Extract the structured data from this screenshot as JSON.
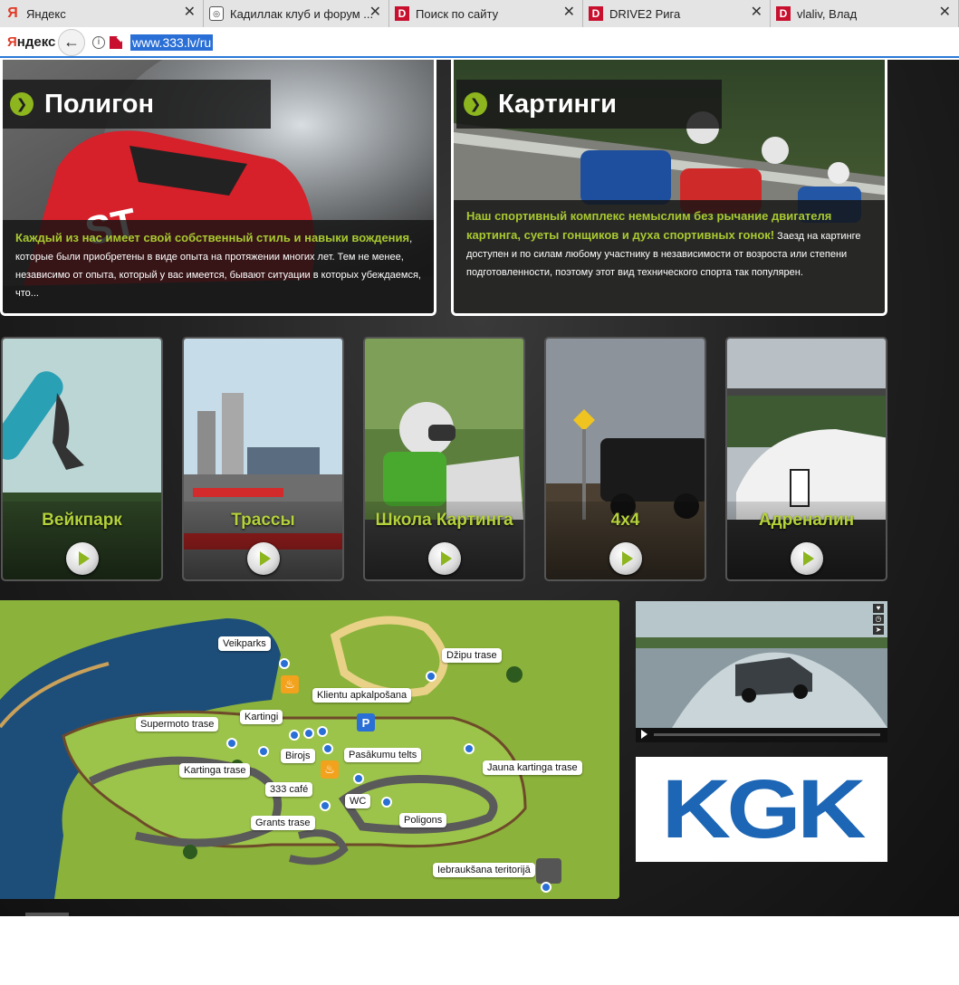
{
  "browser": {
    "tabs": [
      {
        "title": "Яндекс",
        "icon": "yandex-icon",
        "width": 225
      },
      {
        "title": "Кадиллак клуб и форум ...",
        "icon": "cadillac-icon",
        "width": 205
      },
      {
        "title": "Поиск по сайту",
        "icon": "drive2-icon",
        "width": 214
      },
      {
        "title": "DRIVE2 Рига",
        "icon": "drive2-icon",
        "width": 207
      },
      {
        "title": "vlaliv, Влад",
        "icon": "drive2-icon",
        "width": 208
      }
    ],
    "logo_prefix": "Я",
    "logo_rest": "ндекс",
    "url": "www.333.lv/ru"
  },
  "features": {
    "poligon": {
      "title": "Полигон",
      "lead": "Каждый из нас имеет свой собственный стиль и навыки вождения",
      "text": ", которые были приобретены в виде опыта на протяжении многих лет. Тем не менее, независимо от опыта, который у вас имеется, бывают ситуации в которых убеждаемся, что..."
    },
    "karting": {
      "title": "Картинги",
      "lead": "Наш спортивный комплекс немыслим без рычание двигателя картинга, суеты гонщиков и духа спортивных гонок!",
      "text": " Заезд на картинге доступен и по силам любому участнику в независимости от возроста или степени подготовленности, поэтому этот вид технического спорта так популярен."
    }
  },
  "tiles": [
    {
      "label": "Вейкпарк"
    },
    {
      "label": "Трассы"
    },
    {
      "label": "Школа Картинга"
    },
    {
      "label": "4x4"
    },
    {
      "label": "Адреналин"
    }
  ],
  "map": {
    "labels": {
      "veikparks": "Veikparks",
      "dzipu": "Džipu trase",
      "klientu": "Klientu apkalpošana",
      "kartingi": "Kartingi",
      "supermoto": "Supermoto trase",
      "birojs": "Birojs",
      "pasakumu": "Pasākumu telts",
      "jauna": "Jauna kartinga trase",
      "kartinga_trase": "Kartinga trase",
      "cafe": "333 café",
      "wc": "WC",
      "grants": "Grants trase",
      "poligons": "Poligons",
      "iebrauksana": "Iebraukšana teritorijā"
    },
    "parking_symbol": "P"
  },
  "kgk": {
    "text": "KGK"
  }
}
